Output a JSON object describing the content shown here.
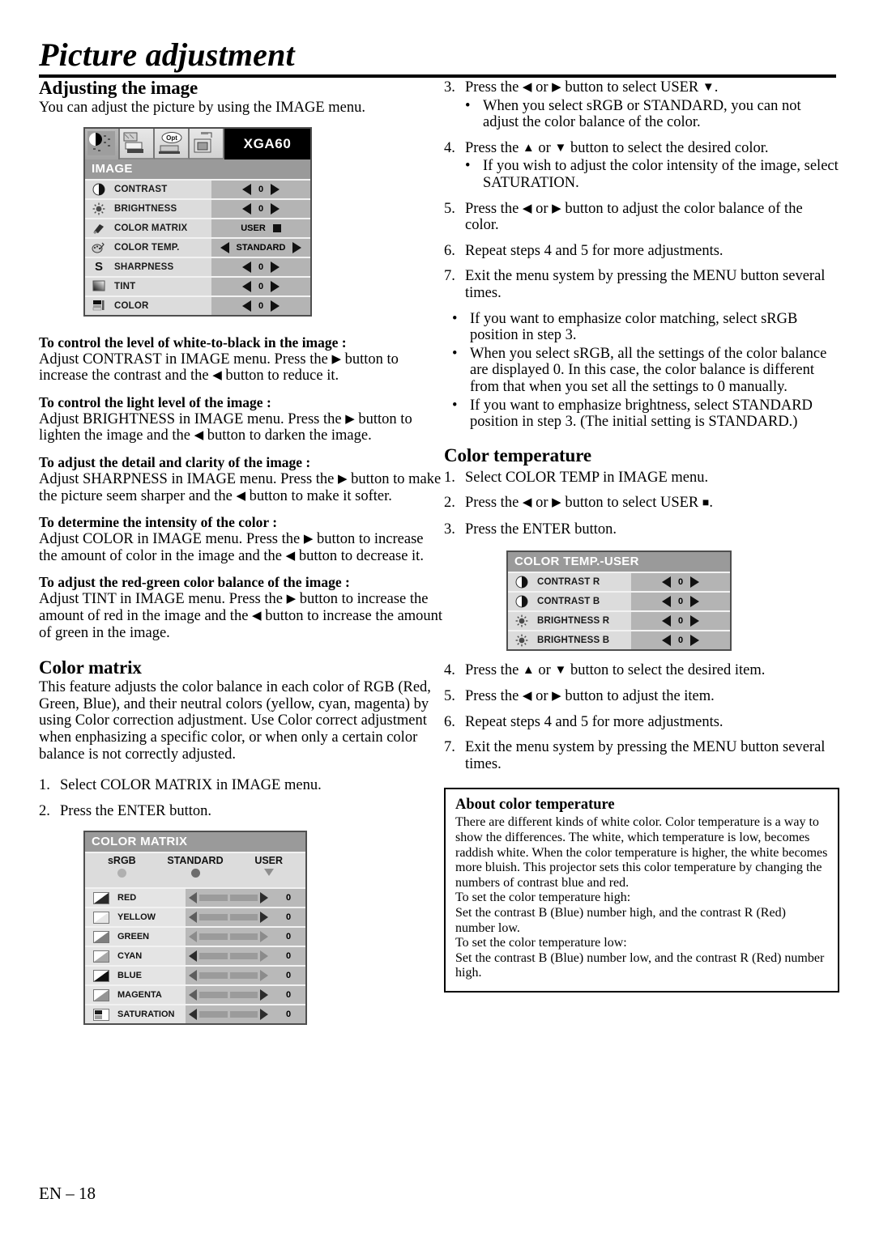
{
  "page": {
    "title": "Picture adjustment",
    "footer": "EN – 18"
  },
  "left": {
    "adjusting": {
      "heading": "Adjusting the image",
      "intro": "You can adjust the picture by using the IMAGE menu."
    },
    "image_menu": {
      "signal": "XGA60",
      "title": "IMAGE",
      "tabs": [
        "image-tab-icon",
        "install-tab-icon",
        "option-tab-icon",
        "feature-tab-icon"
      ],
      "rows": [
        {
          "icon": "contrast-icon",
          "label": "CONTRAST",
          "value": "0",
          "type": "arrows"
        },
        {
          "icon": "brightness-icon",
          "label": "BRIGHTNESS",
          "value": "0",
          "type": "arrows"
        },
        {
          "icon": "color-matrix-icon",
          "label": "COLOR MATRIX",
          "value": "USER",
          "type": "square"
        },
        {
          "icon": "color-temp-icon",
          "label": "COLOR TEMP.",
          "value": "STANDARD",
          "type": "arrows"
        },
        {
          "icon": "sharpness-icon",
          "label": "SHARPNESS",
          "value": "0",
          "type": "arrows"
        },
        {
          "icon": "tint-icon",
          "label": "TINT",
          "value": "0",
          "type": "arrows"
        },
        {
          "icon": "color-icon",
          "label": "COLOR",
          "value": "0",
          "type": "arrows"
        }
      ]
    },
    "sections": [
      {
        "head": "To control the level of white-to-black in the image :",
        "body_1": "Adjust CONTRAST in IMAGE menu.  Press the ",
        "body_2": " button to increase the contrast and the ",
        "body_3": " button to reduce it."
      },
      {
        "head": "To control the light level of the image :",
        "body_1": "Adjust BRIGHTNESS in IMAGE menu.  Press the ",
        "body_2": " button to lighten the image and the ",
        "body_3": " button to darken the image."
      },
      {
        "head": "To adjust the detail and clarity of the image :",
        "body_1": "Adjust SHARPNESS in IMAGE menu.  Press the ",
        "body_2": " button to make the picture seem sharper and the ",
        "body_3": " button to make it softer."
      },
      {
        "head": "To determine the intensity of the color :",
        "body_1": "Adjust COLOR in IMAGE menu.  Press the ",
        "body_2": " button to increase the amount of color in the image and the ",
        "body_3": " button to decrease it."
      },
      {
        "head": "To adjust the red-green color balance of the image :",
        "body_1": "Adjust TINT in IMAGE menu.  Press the ",
        "body_2": " button to increase the amount of red in the image and the ",
        "body_3": " button to increase the amount of green in the image."
      }
    ],
    "color_matrix": {
      "heading": "Color matrix",
      "paragraph": "This feature adjusts the color balance in each color of RGB (Red, Green, Blue), and their neutral colors (yellow, cyan, magenta) by using Color correction adjustment. Use Color correct adjustment when enphasizing a specific color, or when only a certain color balance is not correctly adjusted.",
      "steps": [
        {
          "num": "1.",
          "text": "Select COLOR MATRIX in IMAGE menu."
        },
        {
          "num": "2.",
          "text": "Press the ENTER button."
        }
      ]
    },
    "color_matrix_menu": {
      "title": "COLOR MATRIX",
      "options": [
        {
          "label": "sRGB",
          "marker": "dot-dim"
        },
        {
          "label": "STANDARD",
          "marker": "dot-on"
        },
        {
          "label": "USER",
          "marker": "triangle-down"
        }
      ],
      "rows": [
        {
          "icon": "red-swatch-icon",
          "label": "RED",
          "value": "0"
        },
        {
          "icon": "yellow-swatch-icon",
          "label": "YELLOW",
          "value": "0"
        },
        {
          "icon": "green-swatch-icon",
          "label": "GREEN",
          "value": "0"
        },
        {
          "icon": "cyan-swatch-icon",
          "label": "CYAN",
          "value": "0"
        },
        {
          "icon": "blue-swatch-icon",
          "label": "BLUE",
          "value": "0"
        },
        {
          "icon": "magenta-swatch-icon",
          "label": "MAGENTA",
          "value": "0"
        },
        {
          "icon": "saturation-icon",
          "label": "SATURATION",
          "value": "0"
        }
      ]
    }
  },
  "right": {
    "steps_top": [
      {
        "num": "3.",
        "pre": "Press the ",
        "mid": " or ",
        "post": " button to select USER ",
        "tail": "."
      },
      {
        "num": "4.",
        "pre": "Press the ",
        "mid": " or ",
        "post": " button to select the desired color.",
        "tail": ""
      }
    ],
    "step3": {
      "num": "3.",
      "t1": "Press the ",
      "t2": " or ",
      "t3": " button to select USER ",
      "t4": ".",
      "bullet": "When you select sRGB or STANDARD, you can not adjust the color balance of the color."
    },
    "step4": {
      "num": "4.",
      "t1": "Press the ",
      "t2": " or ",
      "t3": " button to select the desired color.",
      "bullet": "If you wish to adjust the color intensity of the image, select SATURATION."
    },
    "step5": {
      "num": "5.",
      "t1": "Press the ",
      "t2": " or ",
      "t3": " button to adjust the color balance of the color."
    },
    "step6": {
      "num": "6.",
      "text": "Repeat steps 4 and 5 for more adjustments."
    },
    "step7": {
      "num": "7.",
      "text": "Exit the menu system by pressing the MENU button several times."
    },
    "notes": [
      "If you want to emphasize color matching, select sRGB position in step 3.",
      "When you select sRGB, all the settings of the color balance are displayed 0. In this case, the color balance is different from that when you set all the settings to 0 manually.",
      "If you want to emphasize brightness, select STANDARD position in step 3. (The initial setting is STANDARD.)"
    ],
    "color_temperature": {
      "heading": "Color temperature",
      "step1": {
        "num": "1.",
        "text": "Select COLOR TEMP in IMAGE menu."
      },
      "step2": {
        "num": "2.",
        "t1": "Press the ",
        "t2": " or ",
        "t3": " button to select USER ",
        "t4": "."
      },
      "step3": {
        "num": "3.",
        "text": "Press the ENTER button."
      }
    },
    "color_temp_menu": {
      "title": "COLOR TEMP.-USER",
      "rows": [
        {
          "icon": "contrast-icon",
          "label": "CONTRAST R",
          "value": "0"
        },
        {
          "icon": "contrast-icon",
          "label": "CONTRAST B",
          "value": "0"
        },
        {
          "icon": "brightness-icon",
          "label": "BRIGHTNESS R",
          "value": "0"
        },
        {
          "icon": "brightness-icon",
          "label": "BRIGHTNESS B",
          "value": "0"
        }
      ]
    },
    "steps_bottom": {
      "step4": {
        "num": "4.",
        "t1": "Press the ",
        "t2": " or ",
        "t3": " button to select the desired item."
      },
      "step5": {
        "num": "5.",
        "t1": "Press the ",
        "t2": " or ",
        "t3": " button to adjust the item."
      },
      "step6": {
        "num": "6.",
        "text": "Repeat steps 4 and 5 for more adjustments."
      },
      "step7": {
        "num": "7.",
        "text": "Exit the menu system by pressing the MENU button several times."
      }
    },
    "about_box": {
      "heading": "About color temperature",
      "p1": "There are different kinds of white color. Color temperature is a way to show the differences. The white, which temperature is low, becomes raddish white. When the color temperature is higher, the white becomes more bluish. This projector sets this color temperature by changing the numbers of contrast blue and red.",
      "p2": "To set the color temperature high:",
      "p3": "Set the contrast B (Blue) number high, and the contrast R (Red) number low.",
      "p4": "To set the color temperature low:",
      "p5": "Set the contrast B (Blue) number low, and the contrast R (Red) number high."
    }
  },
  "glyphs": {
    "left_tri": "◀",
    "right_tri": "▶",
    "up_tri": "▲",
    "down_tri": "▼",
    "square": "■",
    "bullet": "•"
  },
  "colors": {
    "osd_title_bg": "#9a9a9a",
    "osd_row_bg": "#dcdcdc",
    "osd_value_bg": "#b4b4b4",
    "signal_bg": "#000000"
  }
}
